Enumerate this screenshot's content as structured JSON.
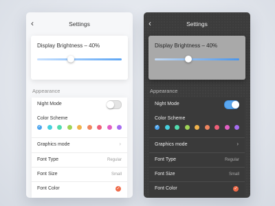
{
  "screens": [
    {
      "theme": "light",
      "header": {
        "back_icon": "‹",
        "title": "Settings"
      },
      "brightness": {
        "label": "Display Brightness – 40%",
        "value_percent": 40
      },
      "section_title": "Appearance",
      "rows": {
        "night_mode": {
          "label": "Night Mode",
          "on": false
        },
        "color_scheme": {
          "label": "Color Scheme"
        },
        "graphics_mode": {
          "label": "Graphics mode",
          "chevron": "›"
        },
        "font_type": {
          "label": "Font Type",
          "value": "Regular"
        },
        "font_size": {
          "label": "Font Size",
          "value": "Small"
        },
        "font_color": {
          "label": "Font Color",
          "check": "✓"
        }
      }
    },
    {
      "theme": "dark",
      "header": {
        "back_icon": "‹",
        "title": "Settings"
      },
      "brightness": {
        "label": "Display Brightness – 40%",
        "value_percent": 40
      },
      "section_title": "Appearance",
      "rows": {
        "night_mode": {
          "label": "Night Mode",
          "on": true
        },
        "color_scheme": {
          "label": "Color Scheme"
        },
        "graphics_mode": {
          "label": "Graphics mode",
          "chevron": "›"
        },
        "font_type": {
          "label": "Font Type",
          "value": "Regular"
        },
        "font_size": {
          "label": "Font Size",
          "value": "Small"
        },
        "font_color": {
          "label": "Font Color",
          "check": "✓"
        }
      }
    }
  ],
  "color_scheme_swatches": [
    "#4aa3ee",
    "#47d0df",
    "#52dcae",
    "#9fd456",
    "#f1b24b",
    "#f0855f",
    "#ef5f79",
    "#e25fc4",
    "#a66df0"
  ],
  "selected_swatch_check": "✓",
  "font_color_hex": "#ef6b4a"
}
